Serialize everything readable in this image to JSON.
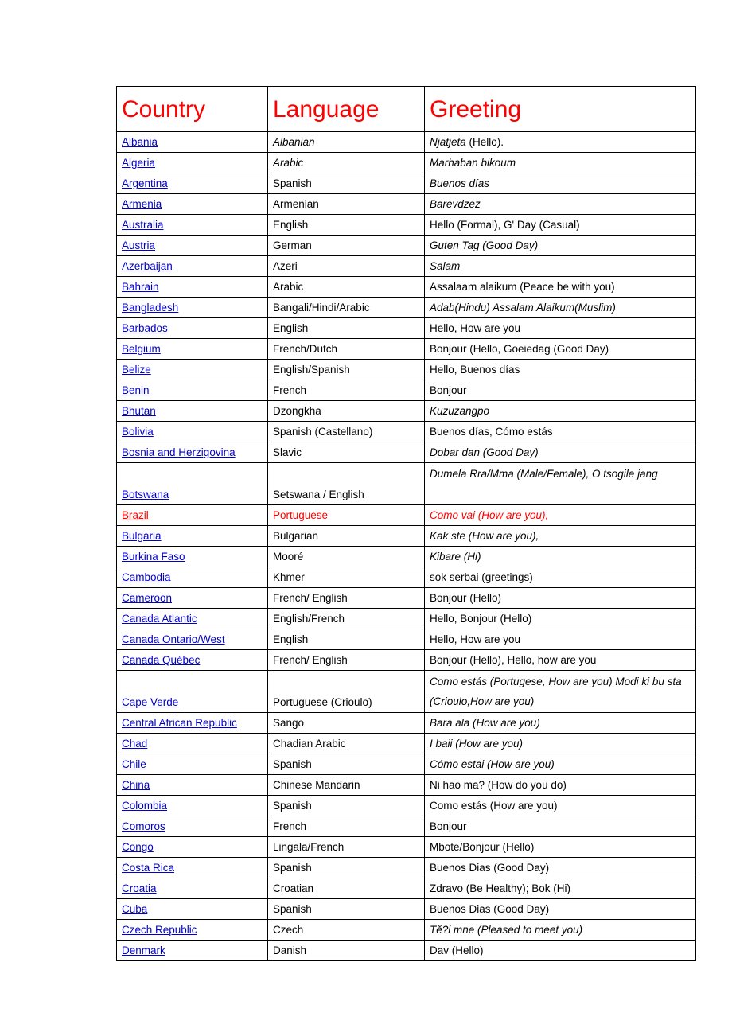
{
  "table": {
    "headers": [
      "Country",
      "Language",
      "Greeting"
    ],
    "rows": [
      {
        "country": "Albania",
        "language": "Albanian",
        "lang_italic": true,
        "greeting_italic": "Njatjeta",
        "greeting_plain": " (Hello)."
      },
      {
        "country": "Algeria",
        "language": "Arabic",
        "lang_italic": true,
        "greeting_italic": "Marhaban bikoum",
        "greeting_plain": ""
      },
      {
        "country": "Argentina",
        "language": "Spanish",
        "lang_italic": false,
        "greeting_italic": "Buenos días",
        "greeting_plain": ""
      },
      {
        "country": "Armenia",
        "language": "Armenian",
        "lang_italic": false,
        "greeting_italic": "Barevdzez",
        "greeting_plain": ""
      },
      {
        "country": "Australia",
        "language": "English",
        "lang_italic": false,
        "greeting_italic": "",
        "greeting_plain": "Hello (Formal), G' Day (Casual)"
      },
      {
        "country": "Austria",
        "language": "German",
        "lang_italic": false,
        "greeting_italic": "Guten Tag (Good Day)",
        "greeting_plain": ""
      },
      {
        "country": "Azerbaijan",
        "language": "Azeri",
        "lang_italic": false,
        "greeting_italic": "Salam",
        "greeting_plain": ""
      },
      {
        "country": "Bahrain",
        "language": "Arabic",
        "lang_italic": false,
        "greeting_italic": "",
        "greeting_plain": "Assalaam alaikum (Peace be with you)"
      },
      {
        "country": "Bangladesh",
        "language": "Bangali/Hindi/Arabic",
        "lang_italic": false,
        "greeting_italic": "Adab(Hindu) Assalam Alaikum(Muslim)",
        "greeting_plain": ""
      },
      {
        "country": "Barbados",
        "language": "English",
        "lang_italic": false,
        "greeting_italic": "",
        "greeting_plain": "Hello, How are you"
      },
      {
        "country": "Belgium",
        "language": "French/Dutch",
        "lang_italic": false,
        "greeting_italic": "",
        "greeting_plain": "Bonjour (Hello, Goeiedag (Good Day)"
      },
      {
        "country": "Belize",
        "language": "English/Spanish",
        "lang_italic": false,
        "greeting_italic": "",
        "greeting_plain": "Hello, Buenos días"
      },
      {
        "country": "Benin",
        "language": "French",
        "lang_italic": false,
        "greeting_italic": "",
        "greeting_plain": "Bonjour"
      },
      {
        "country": "Bhutan",
        "language": "Dzongkha",
        "lang_italic": false,
        "greeting_italic": "Kuzuzangpo",
        "greeting_plain": ""
      },
      {
        "country": "Bolivia",
        "language": "Spanish (Castellano)",
        "lang_italic": false,
        "greeting_italic": "",
        "greeting_plain": "Buenos días, Cómo estás"
      },
      {
        "country": "Bosnia and Herzigovina",
        "language": "Slavic",
        "lang_italic": false,
        "greeting_italic": "Dobar dan (Good Day)",
        "greeting_plain": ""
      },
      {
        "country": "Botswana",
        "language": "Setswana / English",
        "lang_italic": false,
        "tall": true,
        "greeting_italic": "Dumela Rra/Mma (Male/Female), O tsogile jang",
        "greeting_plain": ""
      },
      {
        "country": "Brazil",
        "language": "Portuguese",
        "lang_italic": false,
        "red": true,
        "greeting_italic": "Como vai (How are you),",
        "greeting_plain": ""
      },
      {
        "country": "Bulgaria",
        "language": "Bulgarian",
        "lang_italic": false,
        "greeting_italic": "Kak ste (How are you),",
        "greeting_plain": ""
      },
      {
        "country": "Burkina Faso",
        "language": "Mooré",
        "lang_italic": false,
        "greeting_italic": "Kibare (Hi)",
        "greeting_plain": ""
      },
      {
        "country": "Cambodia",
        "language": "Khmer",
        "lang_italic": false,
        "greeting_italic": "",
        "greeting_plain": "sok serbai (greetings)"
      },
      {
        "country": "Cameroon",
        "language": "French/ English",
        "lang_italic": false,
        "greeting_italic": "",
        "greeting_plain": "Bonjour (Hello)"
      },
      {
        "country": "Canada Atlantic",
        "language": "English/French",
        "lang_italic": false,
        "greeting_italic": "",
        "greeting_plain": "Hello, Bonjour (Hello)"
      },
      {
        "country": "Canada Ontario/West",
        "language": "English",
        "lang_italic": false,
        "greeting_italic": "",
        "greeting_plain": "Hello, How are you"
      },
      {
        "country": "Canada Québec",
        "language": "French/ English",
        "lang_italic": false,
        "greeting_italic": "",
        "greeting_plain": "Bonjour (Hello), Hello, how are you"
      },
      {
        "country": "Cape Verde",
        "language": "Portuguese (Crioulo)",
        "lang_italic": false,
        "tall": true,
        "greeting_italic": "Como estás (Portugese, How are you)  Modi ki bu sta (Crioulo,How are you)",
        "greeting_plain": ""
      },
      {
        "country": "Central African Republic",
        "language": "Sango",
        "lang_italic": false,
        "greeting_italic": "Bara ala (How are you)",
        "greeting_plain": ""
      },
      {
        "country": "Chad",
        "language": "Chadian Arabic",
        "lang_italic": false,
        "greeting_italic": "I baii (How are you)",
        "greeting_plain": ""
      },
      {
        "country": "Chile",
        "language": "Spanish",
        "lang_italic": false,
        "greeting_italic": "Cómo estai (How are you)",
        "greeting_plain": ""
      },
      {
        "country": "China",
        "language": "Chinese Mandarin",
        "lang_italic": false,
        "greeting_italic": "",
        "greeting_plain": "Ni hao ma? (How do you do)"
      },
      {
        "country": "Colombia",
        "language": "Spanish",
        "lang_italic": false,
        "greeting_italic": "",
        "greeting_plain": "Como estás (How are you)"
      },
      {
        "country": "Comoros",
        "language": "French",
        "lang_italic": false,
        "greeting_italic": "",
        "greeting_plain": "Bonjour"
      },
      {
        "country": "Congo",
        "language": "Lingala/French",
        "lang_italic": false,
        "greeting_italic": "",
        "greeting_plain": "Mbote/Bonjour (Hello)"
      },
      {
        "country": "Costa Rica ",
        "language": "Spanish",
        "lang_italic": false,
        "greeting_italic": "",
        "greeting_plain": "Buenos Dias (Good Day)"
      },
      {
        "country": "Croatia ",
        "language": "Croatian",
        "lang_italic": false,
        "greeting_italic": "",
        "greeting_plain": "Zdravo (Be Healthy); Bok (Hi)"
      },
      {
        "country": "Cuba",
        "language": "Spanish",
        "lang_italic": false,
        "greeting_italic": "",
        "greeting_plain": "Buenos Dias (Good Day)"
      },
      {
        "country": "Czech Republic",
        "language": "Czech",
        "lang_italic": false,
        "greeting_italic": "Tě?i mne (Pleased to meet you)",
        "greeting_plain": ""
      },
      {
        "country": "Denmark",
        "language": "Danish",
        "lang_italic": false,
        "greeting_italic": "",
        "greeting_plain": "Dav (Hello)"
      }
    ]
  },
  "colors": {
    "header_text": "#FF0000",
    "link": "#0000CC",
    "highlight_row": "#FF0000",
    "border": "#000000",
    "background": "#FFFFFF"
  }
}
